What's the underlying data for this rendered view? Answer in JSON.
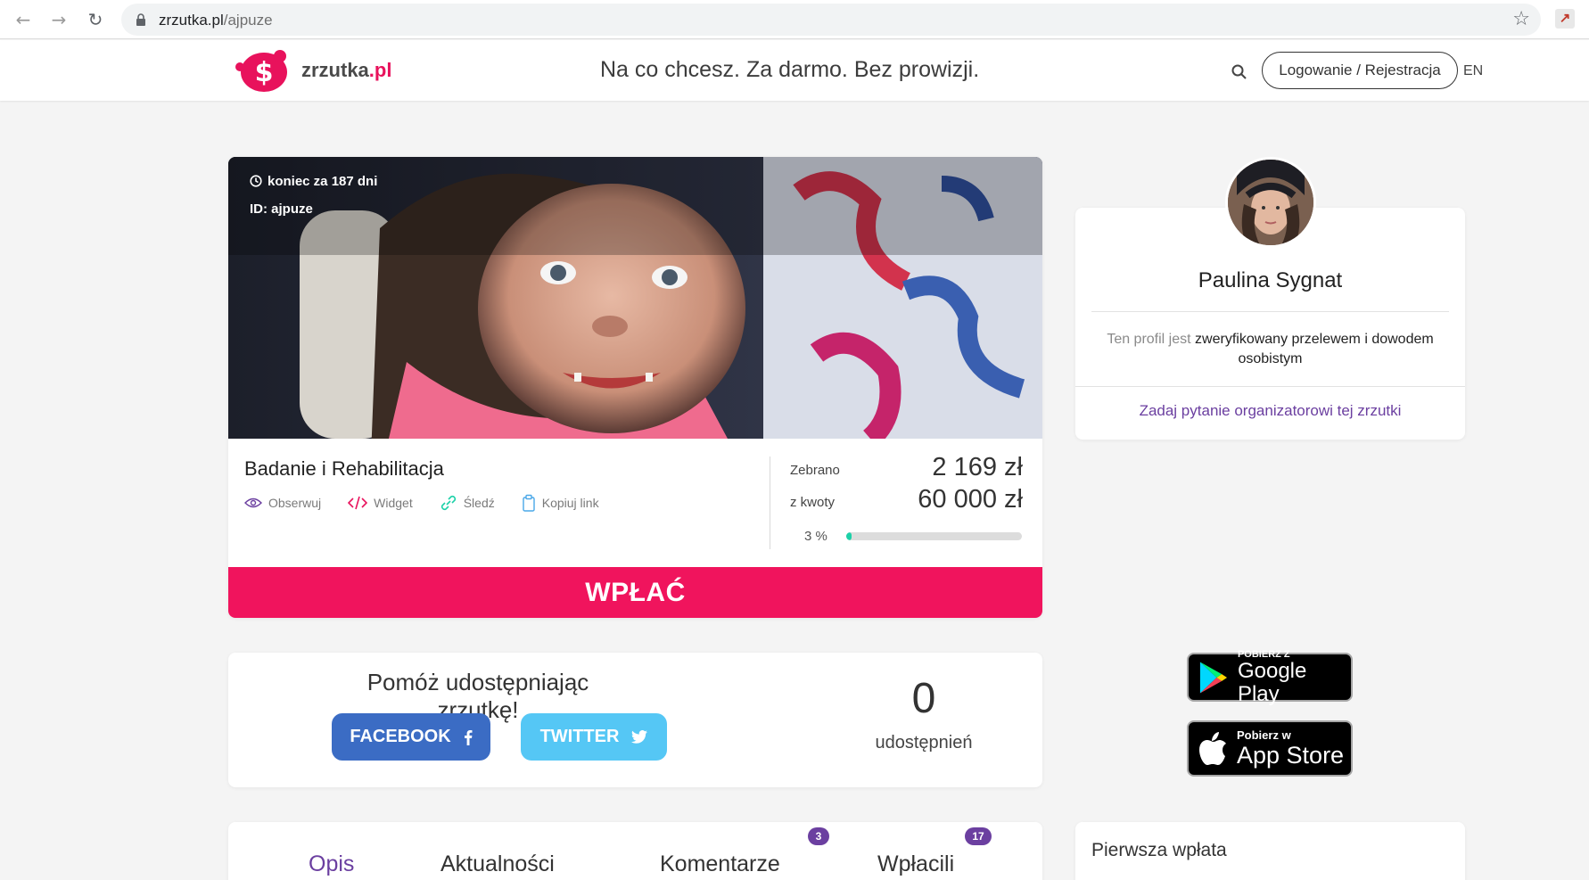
{
  "browser": {
    "url_domain": "zrzutka.pl",
    "url_path": "/ajpuze"
  },
  "header": {
    "logo_text_main": "zrzutka",
    "logo_text_suffix": ".pl",
    "tagline": "Na co chcesz. Za darmo. Bez prowizji.",
    "login_label": "Logowanie / Rejestracja",
    "language": "EN"
  },
  "campaign": {
    "end_label": "koniec za 187 dni",
    "id_label": "ID: ajpuze",
    "title": "Badanie i Rehabilitacja",
    "actions": {
      "observe": "Obserwuj",
      "widget": "Widget",
      "track": "Śledź",
      "copy_link": "Kopiuj link"
    },
    "collected_label": "Zebrano",
    "collected_value": "2 169 zł",
    "goal_label": "z kwoty",
    "goal_value": "60 000 zł",
    "percent_label": "3 %",
    "progress_fraction": 0.03,
    "donate_label": "WPŁAĆ"
  },
  "share": {
    "title": "Pomóż udostępniając zrzutkę!",
    "facebook_label": "FACEBOOK",
    "twitter_label": "TWITTER",
    "count": "0",
    "count_label": "udostępnień"
  },
  "tabs": {
    "description": "Opis",
    "updates": "Aktualności",
    "comments": "Komentarze",
    "comments_count": "3",
    "payers": "Wpłacili",
    "payers_count": "17"
  },
  "organizer": {
    "name": "Paulina Sygnat",
    "verified_prefix": "Ten profil jest",
    "verified_text": "zweryfikowany przelewem i dowodem osobistym",
    "ask_label": "Zadaj pytanie organizatorowi tej zrzutki"
  },
  "stores": {
    "google_small": "POBIERZ Z",
    "google_big": "Google Play",
    "apple_small": "Pobierz w",
    "apple_big": "App Store"
  },
  "first_payment": {
    "title": "Pierwsza wpłata"
  },
  "colors": {
    "brand_pink": "#f0145d",
    "accent_purple": "#6b3fa0",
    "progress_green": "#1cd1a8",
    "facebook_blue": "#3b6cc4",
    "twitter_blue": "#55c7f5"
  }
}
